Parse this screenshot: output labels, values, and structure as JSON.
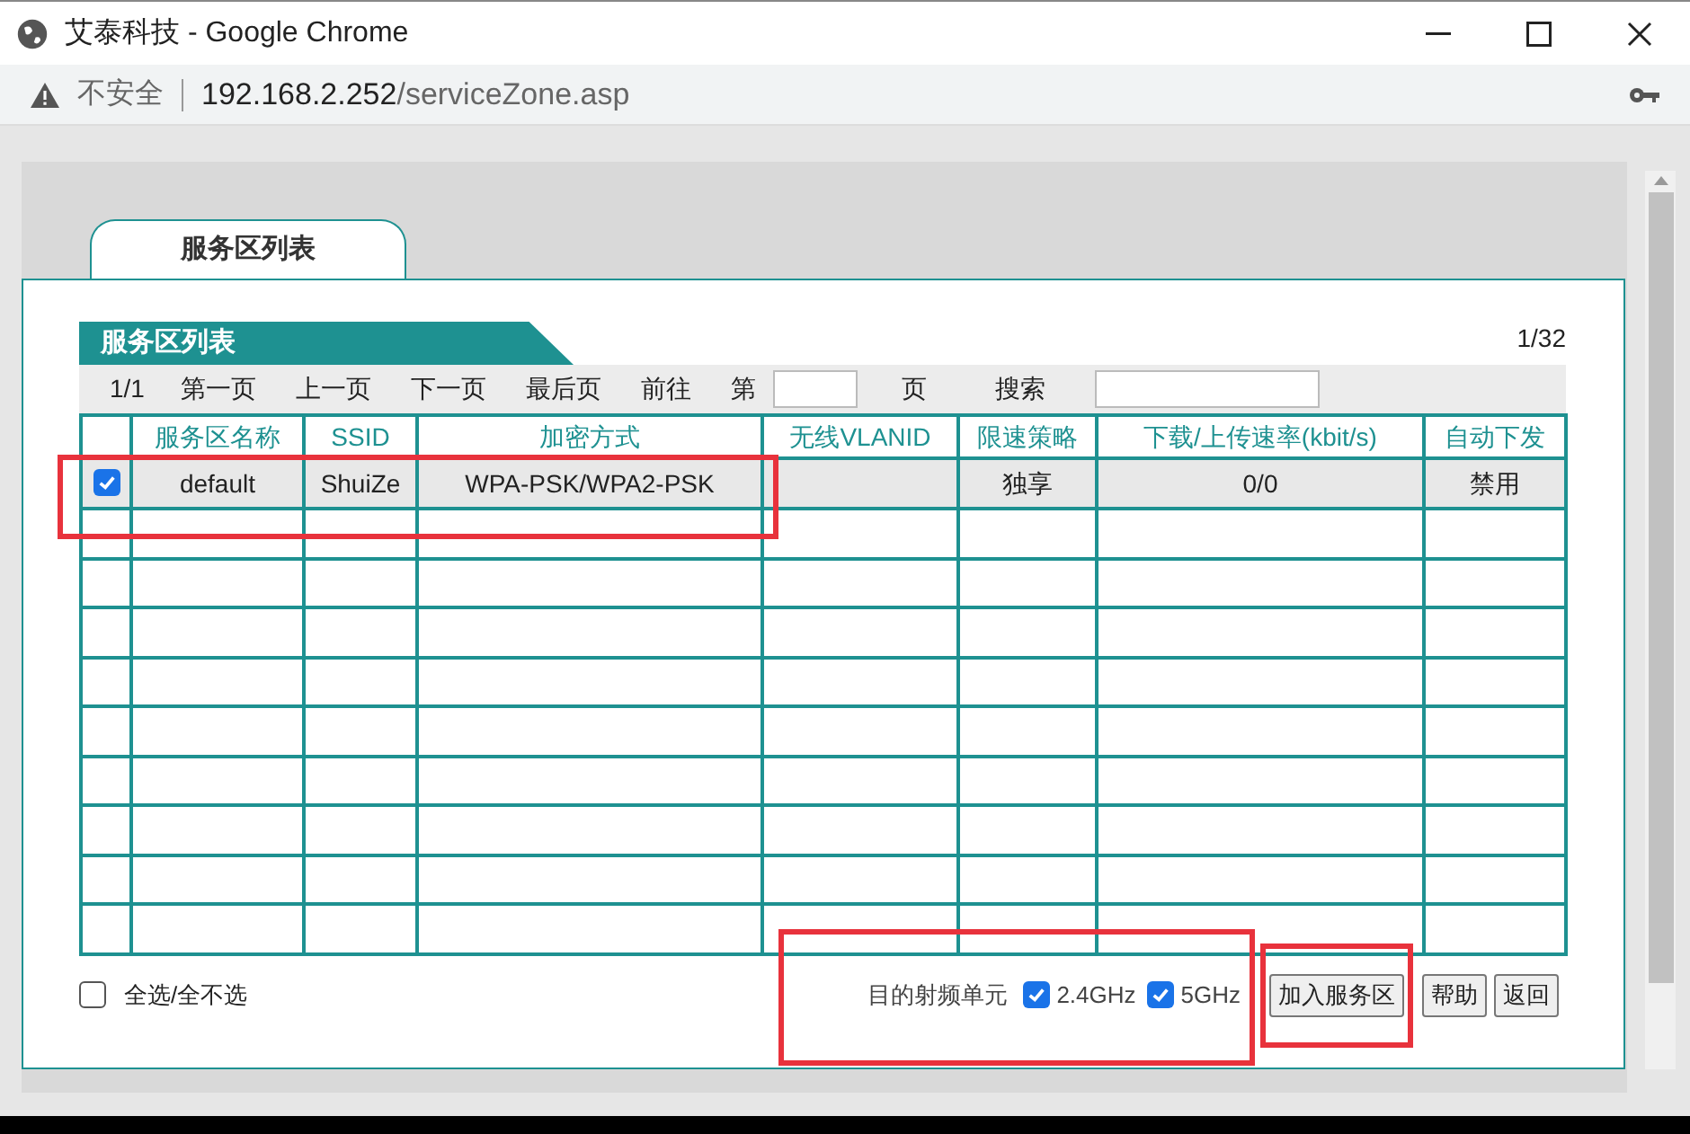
{
  "window": {
    "title": "艾泰科技 - Google Chrome"
  },
  "address_bar": {
    "security": "不安全",
    "host": "192.168.2.252",
    "path": "/serviceZone.asp"
  },
  "tabs": [
    {
      "label": "服务区列表",
      "selected": true
    }
  ],
  "section": {
    "title": "服务区列表",
    "count": "1/32"
  },
  "pager": {
    "page": "1/1",
    "links": [
      "第一页",
      "上一页",
      "下一页",
      "最后页",
      "前往"
    ],
    "goto_prefix": "第",
    "goto_suffix": "页",
    "search_label": "搜索"
  },
  "table": {
    "columns": [
      "服务区名称",
      "SSID",
      "加密方式",
      "无线VLANID",
      "限速策略",
      "下载/上传速率(kbit/s)",
      "自动下发"
    ],
    "rows": [
      {
        "checked": true,
        "cells": [
          "default",
          "ShuiZe",
          "WPA-PSK/WPA2-PSK",
          null,
          "独享",
          "0/0",
          "禁用"
        ]
      }
    ]
  },
  "select_all": {
    "label": "全选/全不选",
    "checked": false
  },
  "radio_unit": {
    "label": "目的射频单元",
    "options": [
      {
        "label": "2.4GHz",
        "checked": true
      },
      {
        "label": "5GHz",
        "checked": true
      }
    ]
  },
  "buttons": [
    "加入服务区",
    "帮助",
    "返回"
  ],
  "highlights": [
    {
      "kind": "frame"
    },
    {
      "kind": "frame"
    },
    {
      "kind": "frame"
    }
  ]
}
